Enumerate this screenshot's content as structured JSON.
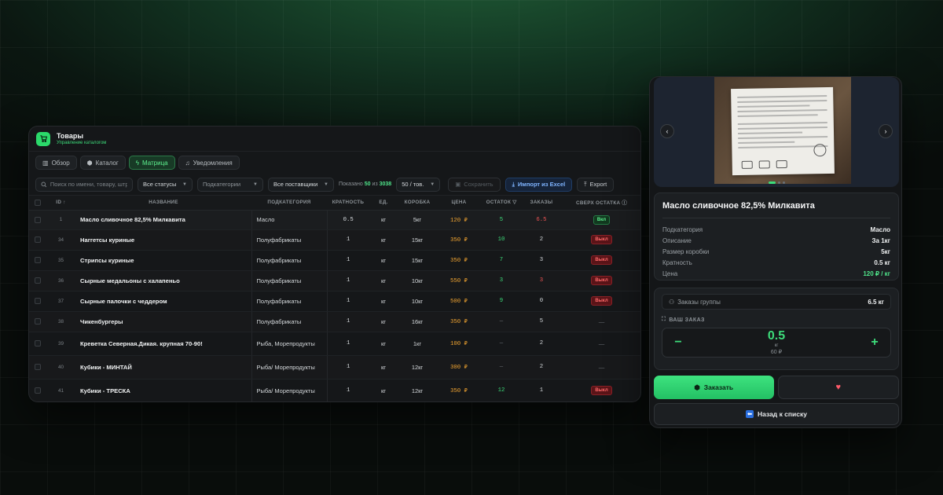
{
  "app": {
    "title": "Товары",
    "subtitle": "Управление каталогом"
  },
  "tabs": [
    {
      "label": "Обзор",
      "icon": "chart-icon"
    },
    {
      "label": "Каталог",
      "icon": "box-icon"
    },
    {
      "label": "Матрица",
      "icon": "bolt-icon",
      "active": true
    },
    {
      "label": "Уведомления",
      "icon": "bell-icon"
    }
  ],
  "toolbar": {
    "search_placeholder": "Поиск по имени, товару, штрихкоду",
    "status_value": "Все статусы",
    "subcategory_value": "Подкатегории",
    "supplier_value": "Все поставщики",
    "shown_prefix": "Показано",
    "shown_count": "50",
    "shown_of": "из",
    "shown_total": "3038",
    "per_page": "50 / тов.",
    "save_label": "Сохранить",
    "import_label": "Импорт из Excel",
    "export_label": "Export"
  },
  "table": {
    "headers": {
      "id": "ID ↑",
      "name": "НАЗВАНИЕ",
      "subcategory": "ПОДКАТЕГОРИЯ",
      "multiplicity": "КРАТНОСТЬ",
      "unit": "ЕД.",
      "box": "КОРОБКА",
      "price": "ЦЕНА",
      "stock": "ОСТАТОК",
      "orders": "ЗАКАЗЫ",
      "over": "СВЕРХ ОСТАТКА"
    },
    "rows": [
      {
        "id": "1",
        "name": "Масло сливочное 82,5% Милкавита",
        "cat": "Масло",
        "mult": "0.5",
        "unit": "кг",
        "box": "5кг",
        "price": "120 ₽",
        "stock": "5",
        "orders": "6.5",
        "orders_red": true,
        "over": "Вкл",
        "over_type": "on"
      },
      {
        "id": "34",
        "name": "Наггетсы куриные",
        "cat": "Полуфабрикаты",
        "mult": "1",
        "unit": "кг",
        "box": "15кг",
        "price": "350 ₽",
        "stock": "10",
        "orders": "2",
        "over": "Выкл",
        "over_type": "off"
      },
      {
        "id": "35",
        "name": "Стрипсы куриные",
        "cat": "Полуфабрикаты",
        "mult": "1",
        "unit": "кг",
        "box": "15кг",
        "price": "350 ₽",
        "stock": "7",
        "orders": "3",
        "over": "Выкл",
        "over_type": "off"
      },
      {
        "id": "36",
        "name": "Сырные медальоны с халапеньо",
        "cat": "Полуфабрикаты",
        "mult": "1",
        "unit": "кг",
        "box": "10кг",
        "price": "550 ₽",
        "stock": "3",
        "orders": "3",
        "orders_red": true,
        "over": "Выкл",
        "over_type": "off"
      },
      {
        "id": "37",
        "name": "Сырные палочки с чеддером",
        "cat": "Полуфабрикаты",
        "mult": "1",
        "unit": "кг",
        "box": "10кг",
        "price": "500 ₽",
        "stock": "9",
        "orders": "0",
        "over": "Выкл",
        "over_type": "off"
      },
      {
        "id": "38",
        "name": "Чикенбургеры",
        "cat": "Полуфабрикаты",
        "mult": "1",
        "unit": "кг",
        "box": "16кг",
        "price": "350 ₽",
        "stock": "—",
        "orders": "5",
        "over": "—",
        "over_type": "none"
      },
      {
        "id": "39",
        "name": "Креветка Северная.Дикая. крупная 70-90!",
        "cat": "Рыба, Морепродукты",
        "mult": "1",
        "unit": "кг",
        "box": "1кг",
        "price": "100 ₽",
        "stock": "—",
        "orders": "2",
        "over": "—",
        "over_type": "none"
      },
      {
        "id": "40",
        "name": "Кубики - МИНТАЙ",
        "cat": "Рыба/ Морепродукты",
        "mult": "1",
        "unit": "кг",
        "box": "12кг",
        "price": "300 ₽",
        "stock": "—",
        "orders": "2",
        "over": "—",
        "over_type": "none"
      },
      {
        "id": "41",
        "name": "Кубики - ТРЕСКА",
        "cat": "Рыба/ Морепродукты",
        "mult": "1",
        "unit": "кг",
        "box": "12кг",
        "price": "350 ₽",
        "stock": "12",
        "orders": "1",
        "over": "Выкл",
        "over_type": "off"
      }
    ]
  },
  "product": {
    "title": "Масло сливочное 82,5% Милкавита",
    "details": [
      {
        "k": "Подкатегория",
        "v": "Масло"
      },
      {
        "k": "Описание",
        "v": "За 1кг"
      },
      {
        "k": "Размер коробки",
        "v": "5кг"
      },
      {
        "k": "Кратность",
        "v": "0.5 кг"
      },
      {
        "k": "Цена",
        "v": "120 ₽ / кг",
        "green": true
      }
    ],
    "group_label": "Заказы группы",
    "group_value": "6.5 кг",
    "your_order_label": "ВАШ ЗАКАЗ",
    "qty": "0.5",
    "qty_unit": "кг",
    "qty_sum": "60 ₽",
    "order_label": "Заказать",
    "back_label": "Назад к списку"
  },
  "colors": {
    "accent": "#3ddc7a",
    "price": "#f2a531",
    "danger": "#f05454",
    "import": "#7fb4ff"
  }
}
